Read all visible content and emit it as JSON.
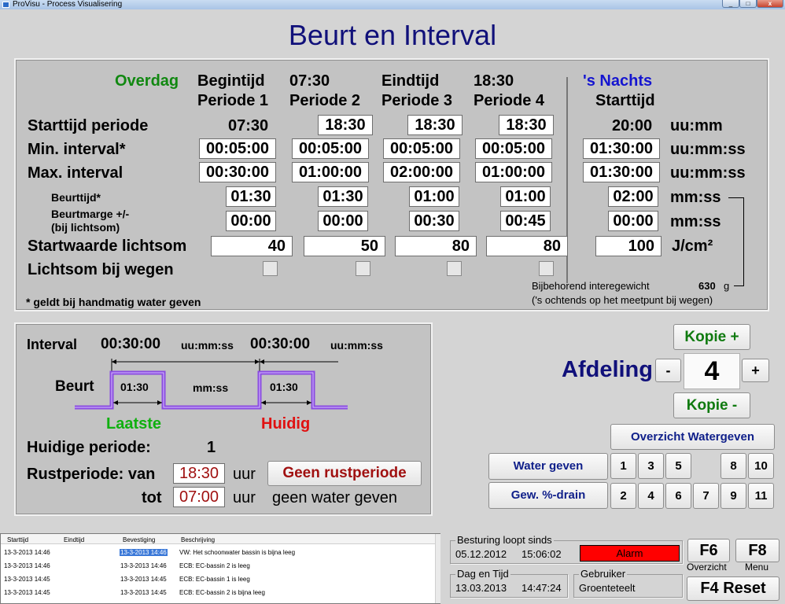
{
  "window": {
    "title": "ProVisu - Process Visualisering",
    "min": "_",
    "max": "□",
    "close": "x"
  },
  "page_title": "Beurt en Interval",
  "top": {
    "overdag": "Overdag",
    "periods": [
      {
        "line1": "Begintijd",
        "line2": "Periode 1",
        "begin": "",
        "starttijd": "07:30",
        "min": "00:05:00",
        "max": "00:30:00",
        "beurttijd": "01:30",
        "beurtmarge": "00:00",
        "lichtsom": "40"
      },
      {
        "line1": "07:30",
        "line2": "Periode 2",
        "begin": "",
        "starttijd": "18:30",
        "min": "00:05:00",
        "max": "01:00:00",
        "beurttijd": "01:30",
        "beurtmarge": "00:00",
        "lichtsom": "50"
      },
      {
        "line1": "Eindtijd",
        "line2": "Periode 3",
        "begin": "",
        "starttijd": "18:30",
        "min": "00:05:00",
        "max": "02:00:00",
        "beurttijd": "01:00",
        "beurtmarge": "00:30",
        "lichtsom": "80"
      },
      {
        "line1": "18:30",
        "line2": "Periode 4",
        "begin": "",
        "starttijd": "18:30",
        "min": "00:05:00",
        "max": "01:00:00",
        "beurttijd": "01:00",
        "beurtmarge": "00:45",
        "lichtsom": "80"
      }
    ],
    "nachts": {
      "title": "'s Nachts",
      "sub": "Starttijd",
      "starttijd": "20:00",
      "min": "01:30:00",
      "max": "01:30:00",
      "beurttijd": "02:00",
      "beurtmarge": "00:00",
      "lichtsom": "100"
    },
    "row_labels": {
      "starttijd": "Starttijd periode",
      "min": "Min. interval*",
      "max": "Max. interval",
      "beurttijd": "Beurttijd*",
      "beurtmarge1": "Beurtmarge +/-",
      "beurtmarge2": "(bij lichtsom)",
      "lichtsom": "Startwaarde lichtsom",
      "wegen": "Lichtsom bij wegen"
    },
    "units": {
      "starttijd": "uu:mm",
      "min": "uu:mm:ss",
      "max": "uu:mm:ss",
      "beurttijd": "mm:ss",
      "beurtmarge": "mm:ss",
      "lichtsom": "J/cm²"
    },
    "footnote": "* geldt bij handmatig water geven",
    "bijbehorend": "Bijbehorend interegewicht",
    "gewicht": "630",
    "gewicht_unit": "g",
    "ochtends": "('s ochtends op het meetpunt bij wegen)"
  },
  "mid": {
    "interval_label": "Interval",
    "interval_last": "00:30:00",
    "interval_unit1": "uu:mm:ss",
    "interval_current": "00:30:00",
    "interval_unit2": "uu:mm:ss",
    "beurt_label": "Beurt",
    "beurt_last": "01:30",
    "beurt_unit": "mm:ss",
    "beurt_current": "01:30",
    "laatste": "Laatste",
    "huidig": "Huidig",
    "huidige_periode_label": "Huidige periode:",
    "huidige_periode": "1",
    "rust_label": "Rustperiode: van",
    "rust_van": "18:30",
    "uur1": "uur",
    "geen_rust_button": "Geen rustperiode",
    "tot_label": "tot",
    "rust_tot": "07:00",
    "uur2": "uur",
    "geen_water": "geen water geven"
  },
  "afdeling": {
    "label": "Afdeling",
    "value": "4",
    "minus": "-",
    "plus": "+",
    "kopie_plus": "Kopie +",
    "kopie_min": "Kopie -",
    "overzicht": "Overzicht Watergeven",
    "water_geven": "Water geven",
    "gew_drain": "Gew. %-drain",
    "row1": [
      "1",
      "3",
      "5",
      "8",
      "10"
    ],
    "row2": [
      "2",
      "4",
      "6",
      "7",
      "9",
      "11"
    ]
  },
  "log": {
    "columns": [
      "Starttijd",
      "Eindtijd",
      "Bevestiging",
      "Beschrijving"
    ],
    "rows": [
      {
        "start": "13-3-2013 14:46",
        "eind": "",
        "bevestiging": "13-3-2013 14:46",
        "beschrijving": "VW: Het schoonwater bassin is bijna leeg",
        "selected": true
      },
      {
        "start": "13-3-2013 14:46",
        "eind": "",
        "bevestiging": "13-3-2013 14:46",
        "beschrijving": "ECB: EC-bassin 2 is leeg",
        "selected": false
      },
      {
        "start": "13-3-2013 14:45",
        "eind": "",
        "bevestiging": "13-3-2013 14:45",
        "beschrijving": "ECB: EC-bassin 1 is leeg",
        "selected": false
      },
      {
        "start": "13-3-2013 14:45",
        "eind": "",
        "bevestiging": "13-3-2013 14:45",
        "beschrijving": "ECB: EC-bassin 2 is bijna leeg",
        "selected": false
      }
    ]
  },
  "status": {
    "besturing_label": "Besturing loopt sinds",
    "besturing_date": "05.12.2012",
    "besturing_time": "15:06:02",
    "alarm": "Alarm",
    "alarm_color": "#ff0000",
    "dag_label": "Dag en Tijd",
    "dag_date": "13.03.2013",
    "dag_time": "14:47:24",
    "gebruiker_label": "Gebruiker",
    "gebruiker": "Groenteteelt",
    "f6": "F6",
    "f6_sub": "Overzicht",
    "f8": "F8",
    "f8_sub": "Menu",
    "f4": "F4 Reset"
  },
  "colors": {
    "title": "#10107a",
    "overdag": "#118811",
    "nachts": "#1515d0",
    "laatste": "#10b010",
    "huidig": "#e01010",
    "pulse": "#8a4be0"
  }
}
